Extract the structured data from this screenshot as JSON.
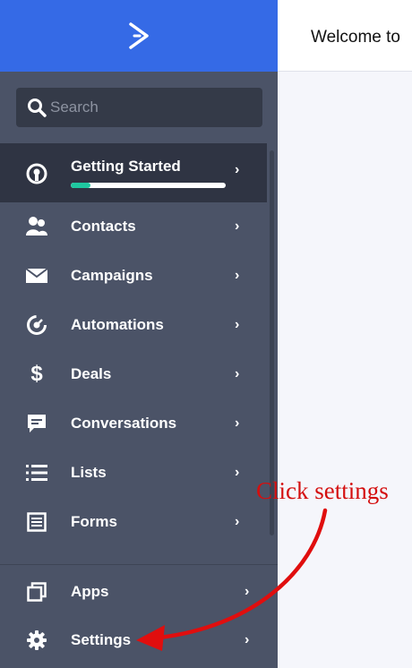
{
  "header": {
    "welcome_text": "Welcome to"
  },
  "search": {
    "placeholder": "Search"
  },
  "getting_started": {
    "label": "Getting Started",
    "progress": 0.13
  },
  "nav": [
    {
      "label": "Contacts",
      "icon": "contacts-icon"
    },
    {
      "label": "Campaigns",
      "icon": "envelope-icon"
    },
    {
      "label": "Automations",
      "icon": "automations-icon"
    },
    {
      "label": "Deals",
      "icon": "dollar-icon"
    },
    {
      "label": "Conversations",
      "icon": "chat-icon"
    },
    {
      "label": "Lists",
      "icon": "list-icon"
    },
    {
      "label": "Forms",
      "icon": "form-icon"
    }
  ],
  "bottom_nav": [
    {
      "label": "Apps",
      "icon": "apps-icon"
    },
    {
      "label": "Settings",
      "icon": "gear-icon"
    }
  ],
  "annotation": {
    "text": "Click settings",
    "color": "#d40f0f"
  },
  "colors": {
    "brand": "#356ae6",
    "sidebar": "#4b5367",
    "progress": "#1fc7a0"
  }
}
